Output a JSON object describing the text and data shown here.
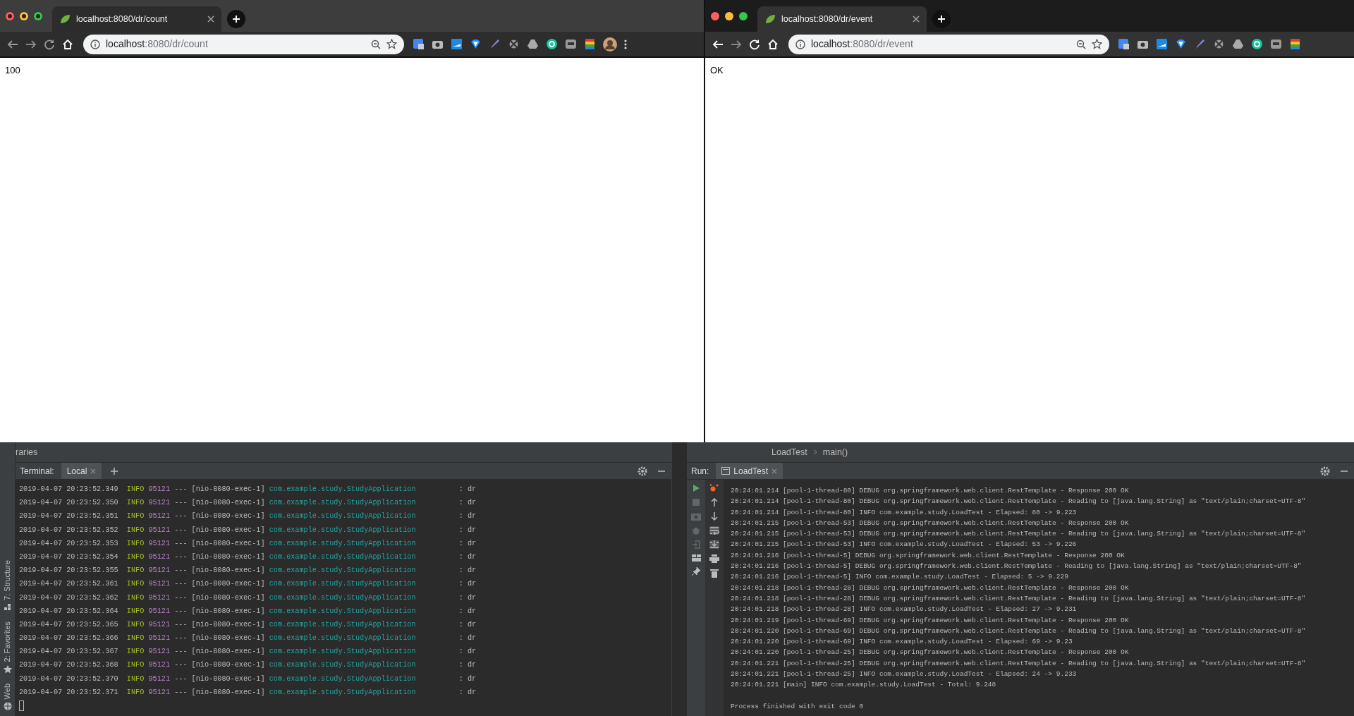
{
  "browsers": [
    {
      "focused": false,
      "tab_title": "localhost:8080/dr/count",
      "url_host": "localhost",
      "url_rest": ":8080/dr/count",
      "body": "100",
      "has_profile": true
    },
    {
      "focused": true,
      "tab_title": "localhost:8080/dr/event",
      "url_host": "localhost",
      "url_rest": ":8080/dr/event",
      "body": "OK",
      "has_profile": false
    }
  ],
  "ide": {
    "project_label": "raries",
    "side_tools": [
      "7: Structure",
      "2: Favorites",
      "Web"
    ],
    "terminal": {
      "title": "Terminal:",
      "tabs": [
        {
          "label": "Local",
          "selected": true
        }
      ],
      "lines": [
        {
          "time": "2019-04-07 20:23:52.349",
          "level": "INFO",
          "pid": "95121",
          "thread": "--- [nio-8080-exec-1]",
          "logger": "com.example.study.StudyApplication",
          "message": ": dr"
        },
        {
          "time": "2019-04-07 20:23:52.350",
          "level": "INFO",
          "pid": "95121",
          "thread": "--- [nio-8080-exec-1]",
          "logger": "com.example.study.StudyApplication",
          "message": ": dr"
        },
        {
          "time": "2019-04-07 20:23:52.351",
          "level": "INFO",
          "pid": "95121",
          "thread": "--- [nio-8080-exec-1]",
          "logger": "com.example.study.StudyApplication",
          "message": ": dr"
        },
        {
          "time": "2019-04-07 20:23:52.352",
          "level": "INFO",
          "pid": "95121",
          "thread": "--- [nio-8080-exec-1]",
          "logger": "com.example.study.StudyApplication",
          "message": ": dr"
        },
        {
          "time": "2019-04-07 20:23:52.353",
          "level": "INFO",
          "pid": "95121",
          "thread": "--- [nio-8080-exec-1]",
          "logger": "com.example.study.StudyApplication",
          "message": ": dr"
        },
        {
          "time": "2019-04-07 20:23:52.354",
          "level": "INFO",
          "pid": "95121",
          "thread": "--- [nio-8080-exec-1]",
          "logger": "com.example.study.StudyApplication",
          "message": ": dr"
        },
        {
          "time": "2019-04-07 20:23:52.355",
          "level": "INFO",
          "pid": "95121",
          "thread": "--- [nio-8080-exec-1]",
          "logger": "com.example.study.StudyApplication",
          "message": ": dr"
        },
        {
          "time": "2019-04-07 20:23:52.361",
          "level": "INFO",
          "pid": "95121",
          "thread": "--- [nio-8080-exec-1]",
          "logger": "com.example.study.StudyApplication",
          "message": ": dr"
        },
        {
          "time": "2019-04-07 20:23:52.362",
          "level": "INFO",
          "pid": "95121",
          "thread": "--- [nio-8080-exec-1]",
          "logger": "com.example.study.StudyApplication",
          "message": ": dr"
        },
        {
          "time": "2019-04-07 20:23:52.364",
          "level": "INFO",
          "pid": "95121",
          "thread": "--- [nio-8080-exec-1]",
          "logger": "com.example.study.StudyApplication",
          "message": ": dr"
        },
        {
          "time": "2019-04-07 20:23:52.365",
          "level": "INFO",
          "pid": "95121",
          "thread": "--- [nio-8080-exec-1]",
          "logger": "com.example.study.StudyApplication",
          "message": ": dr"
        },
        {
          "time": "2019-04-07 20:23:52.366",
          "level": "INFO",
          "pid": "95121",
          "thread": "--- [nio-8080-exec-1]",
          "logger": "com.example.study.StudyApplication",
          "message": ": dr"
        },
        {
          "time": "2019-04-07 20:23:52.367",
          "level": "INFO",
          "pid": "95121",
          "thread": "--- [nio-8080-exec-1]",
          "logger": "com.example.study.StudyApplication",
          "message": ": dr"
        },
        {
          "time": "2019-04-07 20:23:52.368",
          "level": "INFO",
          "pid": "95121",
          "thread": "--- [nio-8080-exec-1]",
          "logger": "com.example.study.StudyApplication",
          "message": ": dr"
        },
        {
          "time": "2019-04-07 20:23:52.370",
          "level": "INFO",
          "pid": "95121",
          "thread": "--- [nio-8080-exec-1]",
          "logger": "com.example.study.StudyApplication",
          "message": ": dr"
        },
        {
          "time": "2019-04-07 20:23:52.371",
          "level": "INFO",
          "pid": "95121",
          "thread": "--- [nio-8080-exec-1]",
          "logger": "com.example.study.StudyApplication",
          "message": ": dr"
        }
      ]
    },
    "run": {
      "breadcrumb": [
        "LoadTest",
        "main()"
      ],
      "title": "Run:",
      "tabs": [
        {
          "label": "LoadTest",
          "selected": true
        }
      ],
      "lines": [
        "20:24:01.214 [pool-1-thread-80] DEBUG org.springframework.web.client.RestTemplate - Response 200 OK",
        "20:24:01.214 [pool-1-thread-80] DEBUG org.springframework.web.client.RestTemplate - Reading to [java.lang.String] as \"text/plain;charset=UTF-8\"",
        "20:24:01.214 [pool-1-thread-80] INFO com.example.study.LoadTest - Elapsed: 80 -> 9.223",
        "20:24:01.215 [pool-1-thread-53] DEBUG org.springframework.web.client.RestTemplate - Response 200 OK",
        "20:24:01.215 [pool-1-thread-53] DEBUG org.springframework.web.client.RestTemplate - Reading to [java.lang.String] as \"text/plain;charset=UTF-8\"",
        "20:24:01.215 [pool-1-thread-53] INFO com.example.study.LoadTest - Elapsed: 53 -> 9.226",
        "20:24:01.216 [pool-1-thread-5] DEBUG org.springframework.web.client.RestTemplate - Response 200 OK",
        "20:24:01.216 [pool-1-thread-5] DEBUG org.springframework.web.client.RestTemplate - Reading to [java.lang.String] as \"text/plain;charset=UTF-8\"",
        "20:24:01.216 [pool-1-thread-5] INFO com.example.study.LoadTest - Elapsed: 5 -> 9.229",
        "20:24:01.218 [pool-1-thread-28] DEBUG org.springframework.web.client.RestTemplate - Response 200 OK",
        "20:24:01.218 [pool-1-thread-28] DEBUG org.springframework.web.client.RestTemplate - Reading to [java.lang.String] as \"text/plain;charset=UTF-8\"",
        "20:24:01.218 [pool-1-thread-28] INFO com.example.study.LoadTest - Elapsed: 27 -> 9.231",
        "20:24:01.219 [pool-1-thread-69] DEBUG org.springframework.web.client.RestTemplate - Response 200 OK",
        "20:24:01.220 [pool-1-thread-69] DEBUG org.springframework.web.client.RestTemplate - Reading to [java.lang.String] as \"text/plain;charset=UTF-8\"",
        "20:24:01.220 [pool-1-thread-69] INFO com.example.study.LoadTest - Elapsed: 69 -> 9.23",
        "20:24:01.220 [pool-1-thread-25] DEBUG org.springframework.web.client.RestTemplate - Response 200 OK",
        "20:24:01.221 [pool-1-thread-25] DEBUG org.springframework.web.client.RestTemplate - Reading to [java.lang.String] as \"text/plain;charset=UTF-8\"",
        "20:24:01.221 [pool-1-thread-25] INFO com.example.study.LoadTest - Elapsed: 24 -> 9.233",
        "20:24:01.221 [main] INFO com.example.study.LoadTest - Total: 9.248"
      ],
      "exit_message": "Process finished with exit code 0"
    }
  }
}
